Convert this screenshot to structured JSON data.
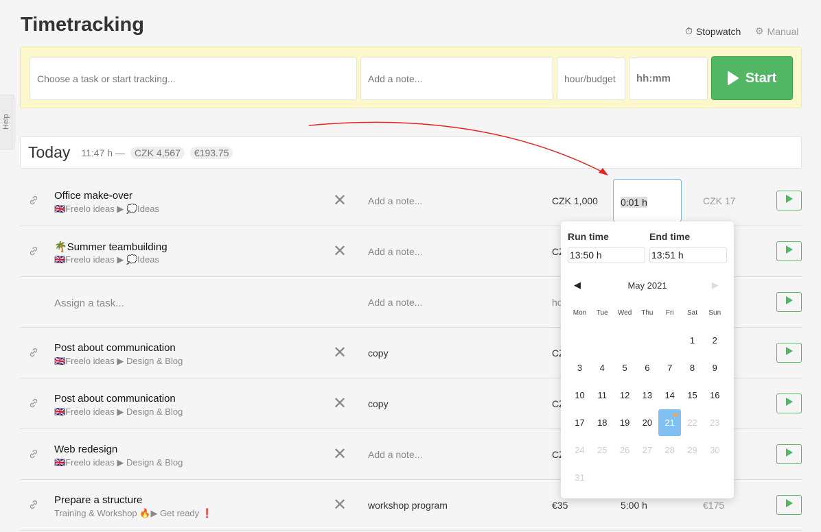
{
  "title": "Timetracking",
  "modes": {
    "stopwatch": "Stopwatch",
    "manual": "Manual"
  },
  "tracker": {
    "task_placeholder": "Choose a task or start tracking...",
    "note_placeholder": "Add a note...",
    "rate_placeholder": "hour/budget",
    "time_placeholder": "hh:mm",
    "start": "Start"
  },
  "help": "Help",
  "today": {
    "label": "Today",
    "duration": "11:47 h —",
    "czk": "CZK 4,567",
    "eur": "€193.75"
  },
  "rows": [
    {
      "name": "Office make-over",
      "path": "🇬🇧Freelo ideas ▶ 💭Ideas",
      "note": "Add a note...",
      "note_ph": true,
      "rate": "CZK 1,000",
      "total": "CZK 17"
    },
    {
      "name": "🌴Summer teambuilding",
      "path": "🇬🇧Freelo ideas ▶ 💭Ideas",
      "note": "Add a note...",
      "note_ph": true,
      "rate": "CZ"
    },
    {
      "name": "Assign a task...",
      "name_ph": true,
      "note": "Add a note...",
      "note_ph": true,
      "rate": "ho"
    },
    {
      "name": "Post about communication",
      "path": "🇬🇧Freelo ideas ▶ Design & Blog",
      "note": "copy",
      "rate": "CZ"
    },
    {
      "name": "Post about communication",
      "path": "🇬🇧Freelo ideas ▶ Design & Blog",
      "note": "copy",
      "rate": "CZ"
    },
    {
      "name": "Web redesign",
      "path": "🇬🇧Freelo ideas ▶ Design & Blog",
      "note": "Add a note...",
      "note_ph": true,
      "rate": "CZ"
    },
    {
      "name": "Prepare a structure",
      "path": "Training & Workshop 🔥▶ Get ready ❗",
      "note": "workshop program",
      "rate": "€35",
      "duration": "5:00 h",
      "total": "€175"
    }
  ],
  "active_duration": "0:01 h",
  "popup": {
    "run_label": "Run time",
    "run_value": "13:50 h",
    "end_label": "End time",
    "end_value": "13:51 h",
    "month": "May 2021",
    "weekdays": [
      "Mon",
      "Tue",
      "Wed",
      "Thu",
      "Fri",
      "Sat",
      "Sun"
    ],
    "first_weekday_index": 5,
    "days_in_month": 31,
    "selected_day": 21,
    "last_enabled_day": 21
  },
  "colors": {
    "accent": "#52b765",
    "highlight": "#fdf8cc",
    "selected": "#7fc1f2",
    "arrow": "#e8231f"
  }
}
